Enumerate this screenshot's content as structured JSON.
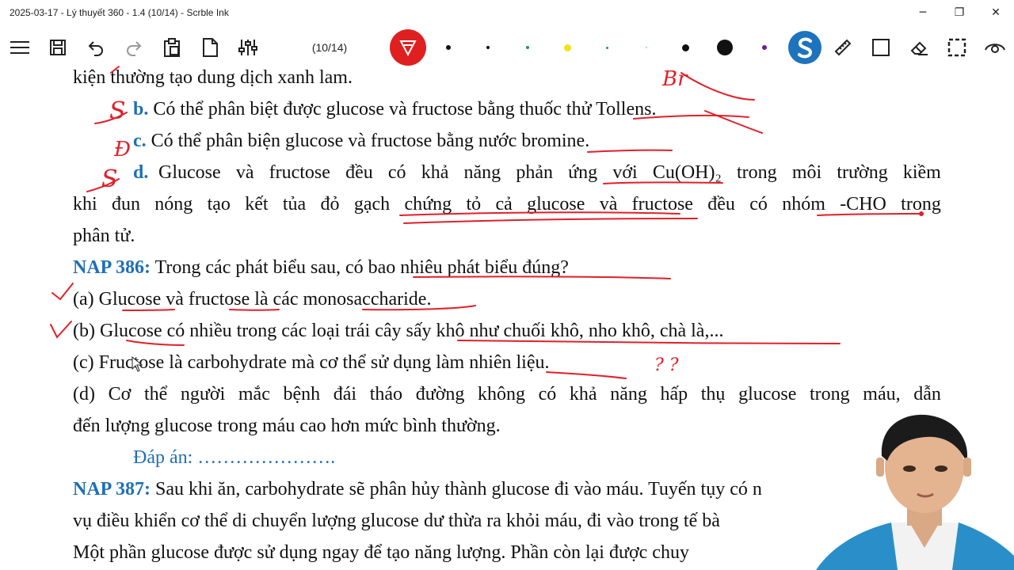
{
  "window": {
    "title": "2025-03-17 - Lý thuyết 360 - 1.4 (10/14) - Scrble Ink",
    "minimize": "─",
    "restore": "❐",
    "close": "✕"
  },
  "toolbar": {
    "page_indicator": "(10/14)",
    "icons": [
      "menu-icon",
      "save-icon",
      "undo-icon",
      "redo-icon",
      "clipboard-icon",
      "new-page-icon",
      "sliders-icon",
      "pen-tool-icon",
      "ruler-icon",
      "rectangle-icon",
      "eraser-icon",
      "selection-icon",
      "view-icon"
    ],
    "pen_colors": [
      "#111111",
      "#111111",
      "#1a9a5a",
      "#f2e21a",
      "#1a9a5a",
      "#7fd7e8",
      "#111111",
      "#111111",
      "#6a1b9a"
    ],
    "active_tool_color": "#e02020",
    "brand_color": "#1e73be"
  },
  "document": {
    "l1": "kiện thường tạo dung dịch xanh lam.",
    "b_label": "b.",
    "b_text": "Có thể phân biệt được glucose và fructose bằng thuốc thử Tollens.",
    "c_label": "c.",
    "c_text": "Có thể phân biện glucose và fructose bằng nước bromine.",
    "d_label": "d.",
    "d_words1": [
      "Glucose",
      "và",
      "fructose",
      "đều",
      "có",
      "khả",
      "năng",
      "phản",
      "ứng",
      "với",
      "Cu(OH)₂",
      "trong",
      "môi",
      "trường",
      "kiềm"
    ],
    "d_words2": [
      "khi",
      "đun",
      "nóng",
      "tạo",
      "kết",
      "tủa",
      "đỏ",
      "gạch",
      "chứng",
      "tỏ",
      "cả",
      "glucose",
      "và",
      "fructose",
      "đều",
      "có",
      "nhóm",
      "-CHO",
      "trong"
    ],
    "d_line3": "phân tử.",
    "nap386_label": "NAP 386:",
    "nap386_text": "Trong các phát biểu sau, có bao nhiêu phát biểu đúng?",
    "a": "(a) Glucose và fructose là các monosaccharide.",
    "b": "(b) Glucose có nhiều trong các loại trái cây sấy khô như chuối khô, nho khô, chà là,...",
    "c": "(c) Fructose là carbohydrate mà cơ thể sử dụng làm nhiên liệu.",
    "d_words_1": [
      "(d)",
      "Cơ",
      "thể",
      "người",
      "mắc",
      "bệnh",
      "đái",
      "tháo",
      "đường",
      "không",
      "có",
      "khả",
      "năng",
      "hấp",
      "thụ",
      "glucose",
      "trong",
      "máu,",
      "dẫn"
    ],
    "d_line2": "đến lượng glucose trong máu cao hơn mức bình thường.",
    "answer": "Đáp án: ………………….",
    "nap387_label": "NAP 387:",
    "nap387_text": "Sau khi ăn, carbohydrate sẽ phân hủy thành glucose đi vào máu. Tuyến tụy có n",
    "p387_l2": "vụ điều khiển cơ thể di chuyển lượng glucose dư thừa ra khỏi máu, đi vào trong tế bà",
    "p387_l3": "Một phần glucose được sử dụng ngay để tạo năng lượng. Phần còn lại được chuy"
  },
  "annotations": {
    "br": "Br",
    "s1": "S",
    "c_mark": "Đ",
    "s2": "S",
    "qq": "? ?",
    "ink_color": "#e0202a"
  }
}
